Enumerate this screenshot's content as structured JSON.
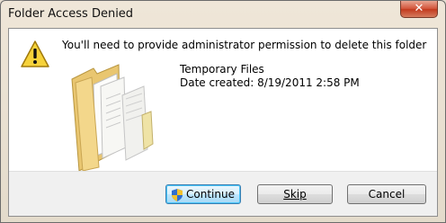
{
  "window": {
    "title": "Folder Access Denied",
    "close_label": "✕"
  },
  "message": "You'll need to provide administrator permission to delete this folder",
  "file": {
    "name": "Temporary Files",
    "date_created": "Date created: 8/19/2011 2:58 PM"
  },
  "buttons": {
    "continue_label": "Continue",
    "skip_label": "Skip",
    "cancel_label": "Cancel"
  },
  "icons": {
    "warning": "warning-icon",
    "folder": "folder-icon",
    "shield": "uac-shield-icon",
    "close": "close-icon"
  },
  "colors": {
    "warning_yellow": "#f6d23a",
    "folder_yellow": "#f3d78b",
    "close_red": "#c23a1e"
  }
}
